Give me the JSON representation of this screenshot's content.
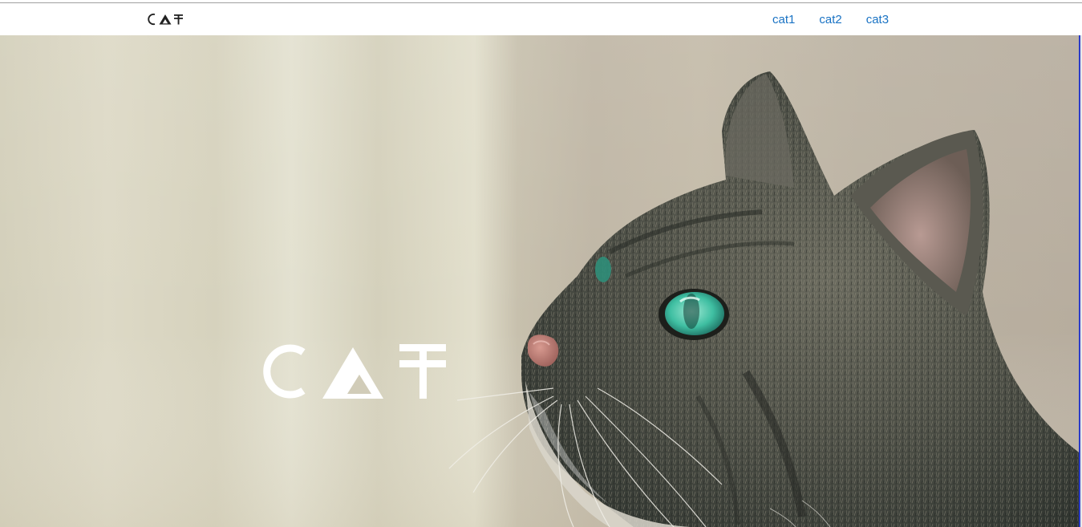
{
  "site": {
    "logo_text": "CAT"
  },
  "nav": {
    "links": [
      {
        "label": "cat1"
      },
      {
        "label": "cat2"
      },
      {
        "label": "cat3"
      }
    ]
  },
  "hero": {
    "image": "tabby-cat-looking-up-photo",
    "logo_text": "CAT",
    "logo_color": "#ffffff"
  },
  "colors": {
    "nav_background": "#ffffff",
    "link": "#1a73c4",
    "logo_dark": "#222222"
  }
}
